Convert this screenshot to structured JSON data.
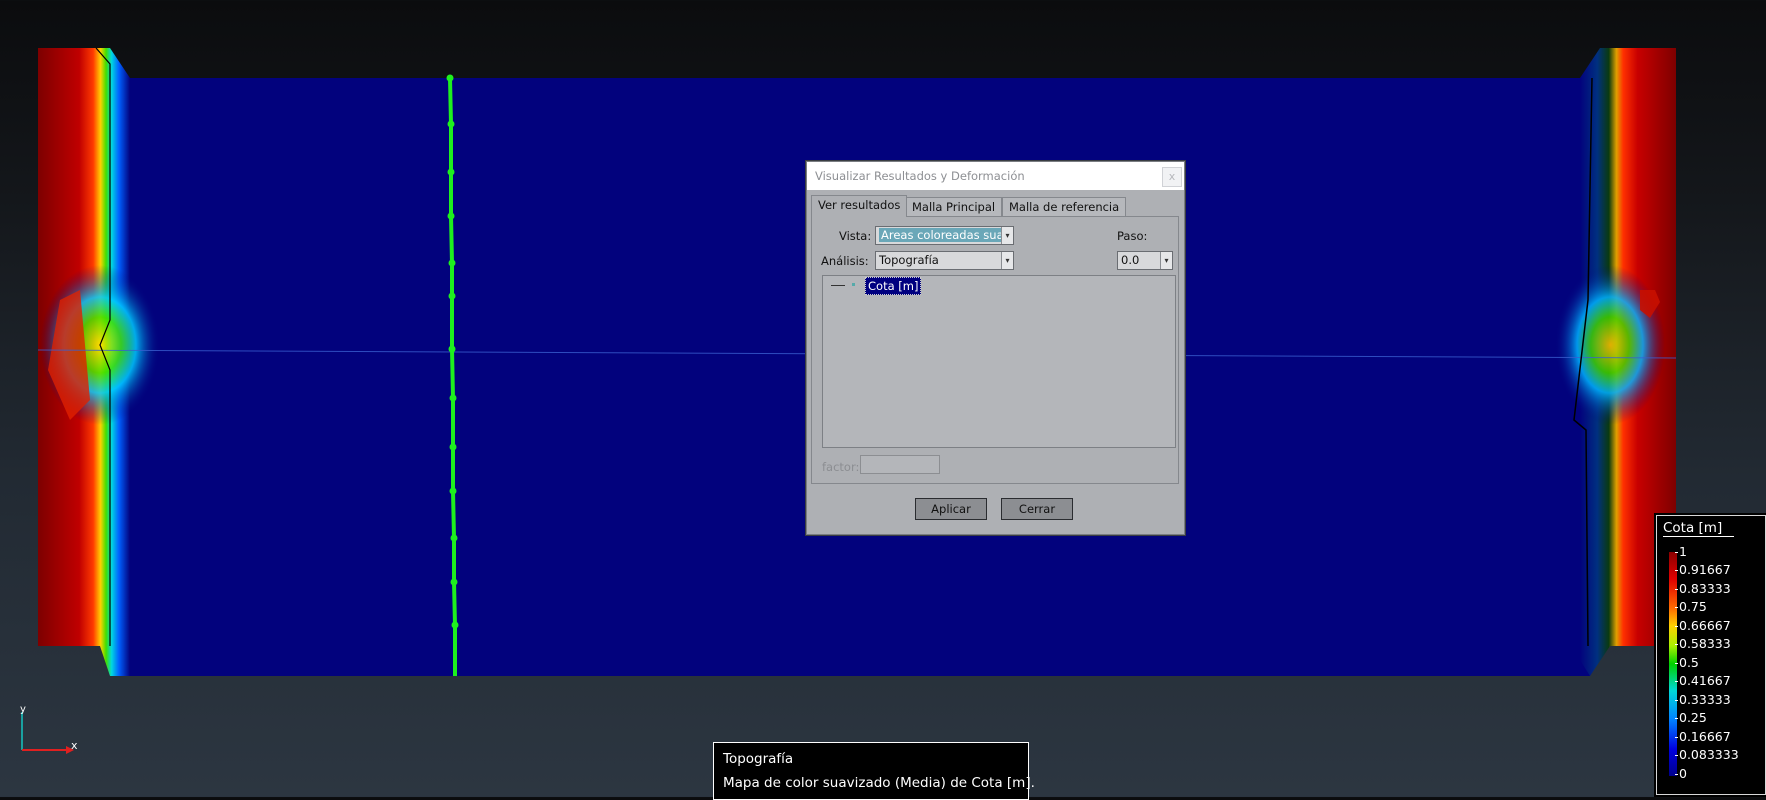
{
  "dialog": {
    "title": "Visualizar Resultados y Deformación",
    "close_label": "x",
    "tabs": [
      {
        "label": "Ver resultados",
        "active": true
      },
      {
        "label": "Malla Principal",
        "active": false
      },
      {
        "label": "Malla de referencia",
        "active": false
      }
    ],
    "vista_label": "Vista:",
    "vista_value": "Areas coloreadas suave",
    "analisis_label": "Análisis:",
    "analisis_value": "Topografía",
    "paso_label": "Paso:",
    "paso_value": "0.0",
    "result_item": "Cota [m]",
    "factor_label": "factor:",
    "factor_value": "",
    "apply_label": "Aplicar",
    "close_button_label": "Cerrar"
  },
  "legend": {
    "title": "Cota [m]",
    "ticks": [
      "1",
      "0.91667",
      "0.83333",
      "0.75",
      "0.66667",
      "0.58333",
      "0.5",
      "0.41667",
      "0.33333",
      "0.25",
      "0.16667",
      "0.083333",
      "0"
    ]
  },
  "info": {
    "line1": "Topografía",
    "line2": "Mapa de color suavizado (Media) de Cota [m]."
  },
  "axes": {
    "x_label": "x",
    "y_label": "y"
  },
  "colors": {
    "field_blue": "#02027d",
    "curve_green": "#1ef01e",
    "selection_navy": "#000080"
  }
}
